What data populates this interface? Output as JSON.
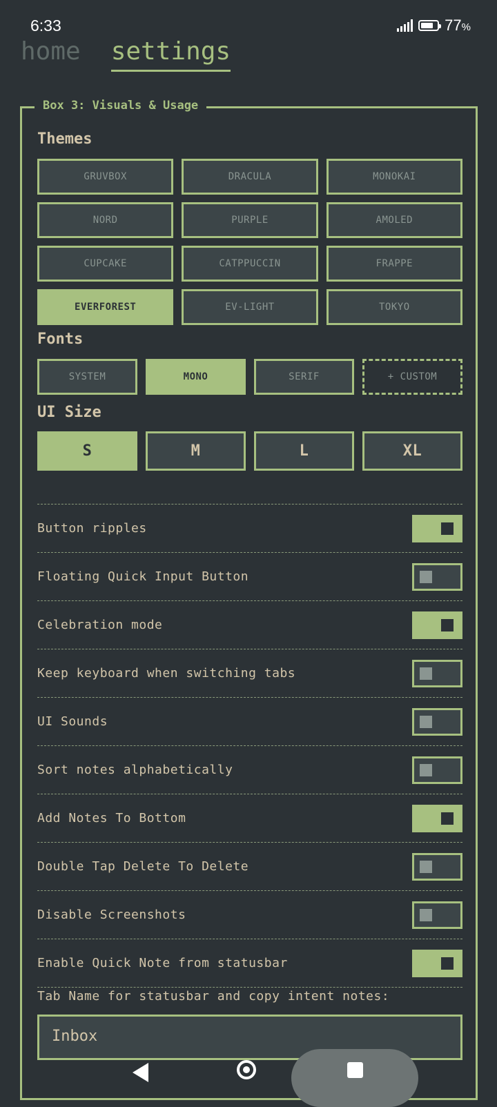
{
  "status_bar": {
    "time": "6:33",
    "battery_percent": "77",
    "battery_unit": "%"
  },
  "top_nav": {
    "home": "home",
    "settings": "settings"
  },
  "box": {
    "title": "Box 3: Visuals & Usage"
  },
  "themes": {
    "title": "Themes",
    "options": [
      "GRUVBOX",
      "DRACULA",
      "MONOKAI",
      "NORD",
      "PURPLE",
      "AMOLED",
      "CUPCAKE",
      "CATPPUCCIN",
      "FRAPPE",
      "EVERFOREST",
      "EV-LIGHT",
      "TOKYO"
    ],
    "selected": "EVERFOREST"
  },
  "fonts": {
    "title": "Fonts",
    "options": [
      "SYSTEM",
      "MONO",
      "SERIF",
      "+ CUSTOM"
    ],
    "selected": "MONO"
  },
  "ui_size": {
    "title": "UI Size",
    "options": [
      "S",
      "M",
      "L",
      "XL"
    ],
    "selected": "S"
  },
  "toggles": [
    {
      "label": "Button ripples",
      "on": true
    },
    {
      "label": "Floating Quick Input Button",
      "on": false
    },
    {
      "label": "Celebration mode",
      "on": true
    },
    {
      "label": "Keep keyboard when switching tabs",
      "on": false
    },
    {
      "label": "UI Sounds",
      "on": false
    },
    {
      "label": "Sort notes alphabetically",
      "on": false
    },
    {
      "label": "Add Notes To Bottom",
      "on": true
    },
    {
      "label": "Double Tap Delete To Delete",
      "on": false
    },
    {
      "label": "Disable Screenshots",
      "on": false
    },
    {
      "label": "Enable Quick Note from statusbar",
      "on": true
    }
  ],
  "tab_name": {
    "label": "Tab Name for statusbar and copy intent notes:",
    "value": "Inbox"
  },
  "colors": {
    "background": "#2c3236",
    "accent": "#a7c080",
    "surface": "#3c4548",
    "text": "#d3c6aa",
    "muted": "#8a9591"
  }
}
